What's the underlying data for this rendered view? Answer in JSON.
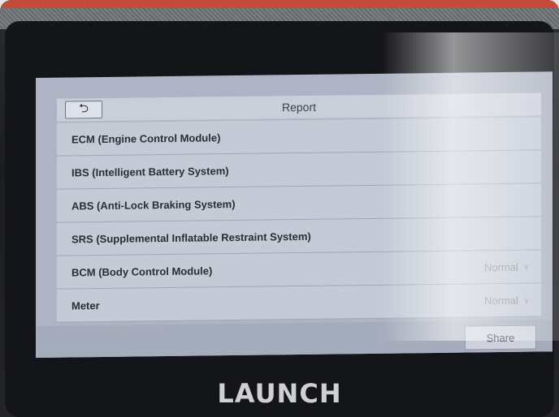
{
  "header": {
    "back_icon": "back-arrow-icon",
    "title": "Report"
  },
  "report": {
    "items": [
      {
        "label": "ECM (Engine Control Module)",
        "status": ""
      },
      {
        "label": "IBS (Intelligent Battery System)",
        "status": ""
      },
      {
        "label": "ABS (Anti-Lock Braking System)",
        "status": ""
      },
      {
        "label": "SRS (Supplemental Inflatable Restraint System)",
        "status": ""
      },
      {
        "label": "BCM (Body Control Module)",
        "status": "Normal"
      },
      {
        "label": "Meter",
        "status": "Normal"
      }
    ]
  },
  "footer": {
    "share_label": "Share"
  },
  "device": {
    "brand": "LAUNCH",
    "accent_color": "#c64a3a"
  }
}
